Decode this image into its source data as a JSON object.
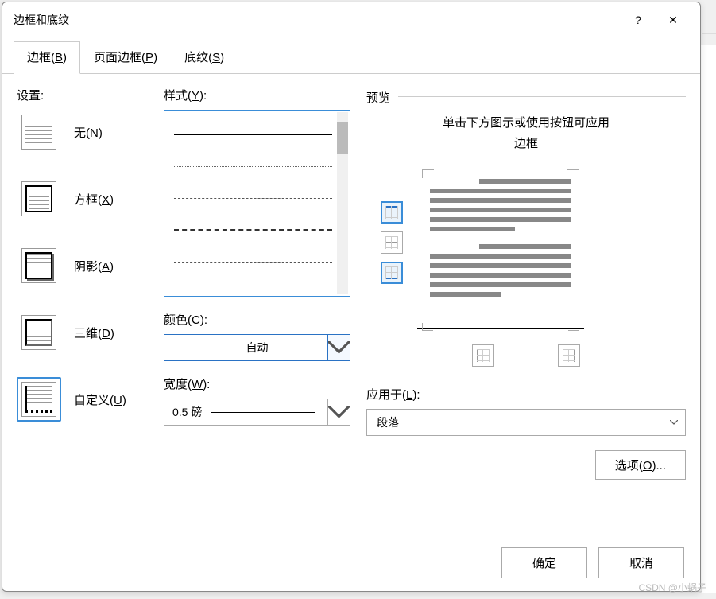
{
  "dialog": {
    "title": "边框和底纹",
    "help_icon": "?",
    "close_icon": "✕"
  },
  "tabs": {
    "borders": {
      "label": "边框",
      "accel": "B"
    },
    "page_border": {
      "label": "页面边框",
      "accel": "P"
    },
    "shading": {
      "label": "底纹",
      "accel": "S"
    }
  },
  "settings": {
    "label": "设置:",
    "items": {
      "none": {
        "label": "无",
        "accel": "N"
      },
      "box": {
        "label": "方框",
        "accel": "X"
      },
      "shadow": {
        "label": "阴影",
        "accel": "A"
      },
      "threed": {
        "label": "三维",
        "accel": "D"
      },
      "custom": {
        "label": "自定义",
        "accel": "U"
      }
    }
  },
  "style": {
    "label": "样式",
    "accel": "Y"
  },
  "color": {
    "label": "颜色",
    "accel": "C",
    "value": "自动"
  },
  "width": {
    "label": "宽度",
    "accel": "W",
    "value": "0.5 磅"
  },
  "preview": {
    "label": "预览",
    "hint_line1": "单击下方图示或使用按钮可应用",
    "hint_line2": "边框"
  },
  "apply_to": {
    "label": "应用于",
    "accel": "L",
    "value": "段落"
  },
  "options_btn": {
    "label": "选项",
    "accel": "O",
    "suffix": "..."
  },
  "footer": {
    "ok": "确定",
    "cancel": "取消"
  },
  "watermark": "CSDN @小蜗子"
}
